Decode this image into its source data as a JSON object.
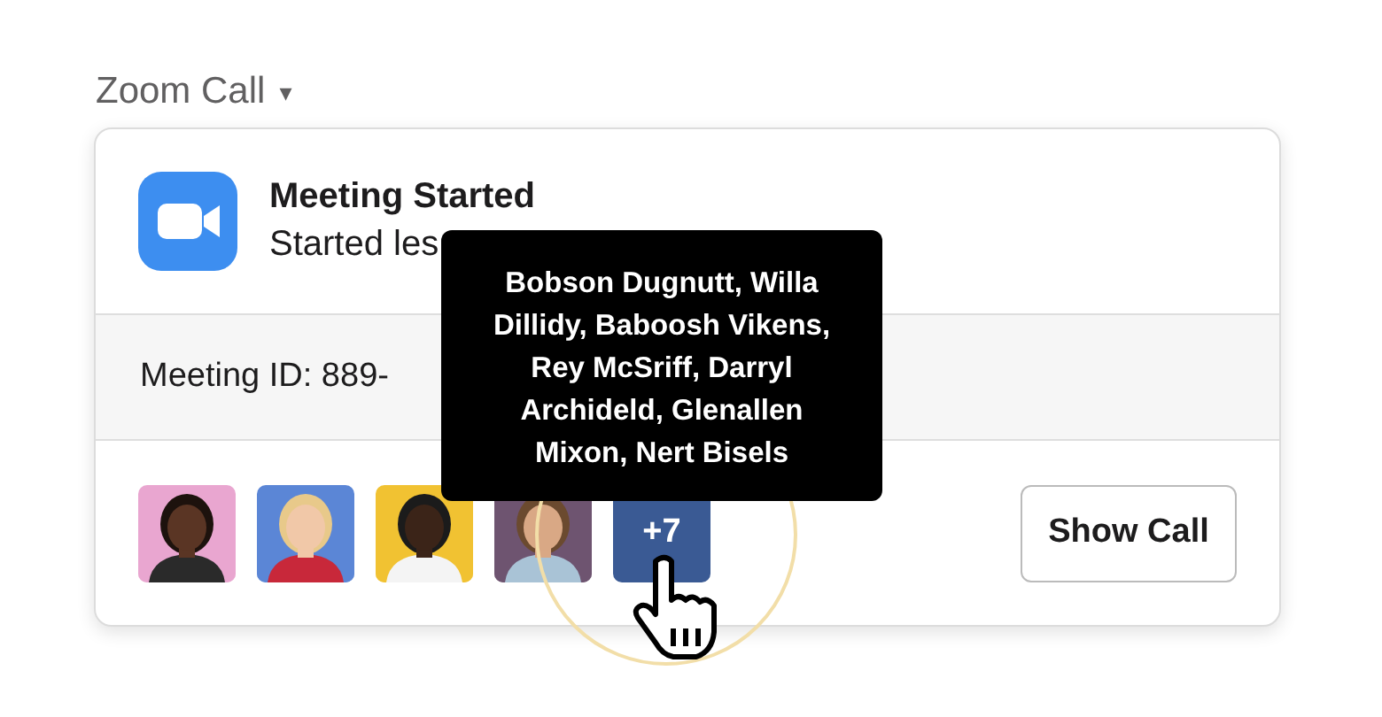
{
  "section": {
    "title": "Zoom Call",
    "caret": "▾"
  },
  "card": {
    "title": "Meeting Started",
    "subtitle": "Started les",
    "meeting_id": "Meeting ID: 889-",
    "more": {
      "label": "+7"
    },
    "button": "Show Call"
  },
  "tooltip": {
    "text": "Bobson Dugnutt, Willa Dillidy, Baboosh Vikens, Rey McSriff, Darryl Archideld, Glenallen Mixon, Nert Bisels"
  }
}
